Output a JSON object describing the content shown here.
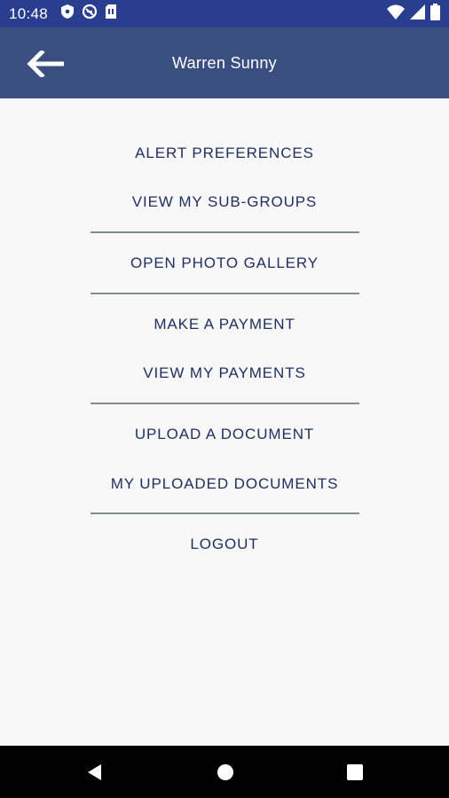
{
  "status_bar": {
    "time": "10:48",
    "left_icons": [
      "shield-icon",
      "do-not-disturb-icon",
      "sim-card-icon"
    ],
    "right_icons": [
      "wifi-icon",
      "signal-icon",
      "battery-icon"
    ]
  },
  "app_bar": {
    "title": "Warren Sunny",
    "back_icon": "back-arrow-icon",
    "color": "#3a4f80"
  },
  "menu": {
    "alert_preferences": "ALERT PREFERENCES",
    "view_sub_groups": "VIEW MY SUB-GROUPS",
    "open_photo_gallery": "OPEN PHOTO GALLERY",
    "make_payment": "MAKE A PAYMENT",
    "view_payments": "VIEW MY PAYMENTS",
    "upload_document": "UPLOAD A DOCUMENT",
    "uploaded_documents": "MY UPLOADED DOCUMENTS",
    "logout": "LOGOUT",
    "text_color": "#1f3060"
  },
  "nav_bar": {
    "buttons": [
      "back-triangle-icon",
      "home-circle-icon",
      "recents-square-icon"
    ]
  }
}
